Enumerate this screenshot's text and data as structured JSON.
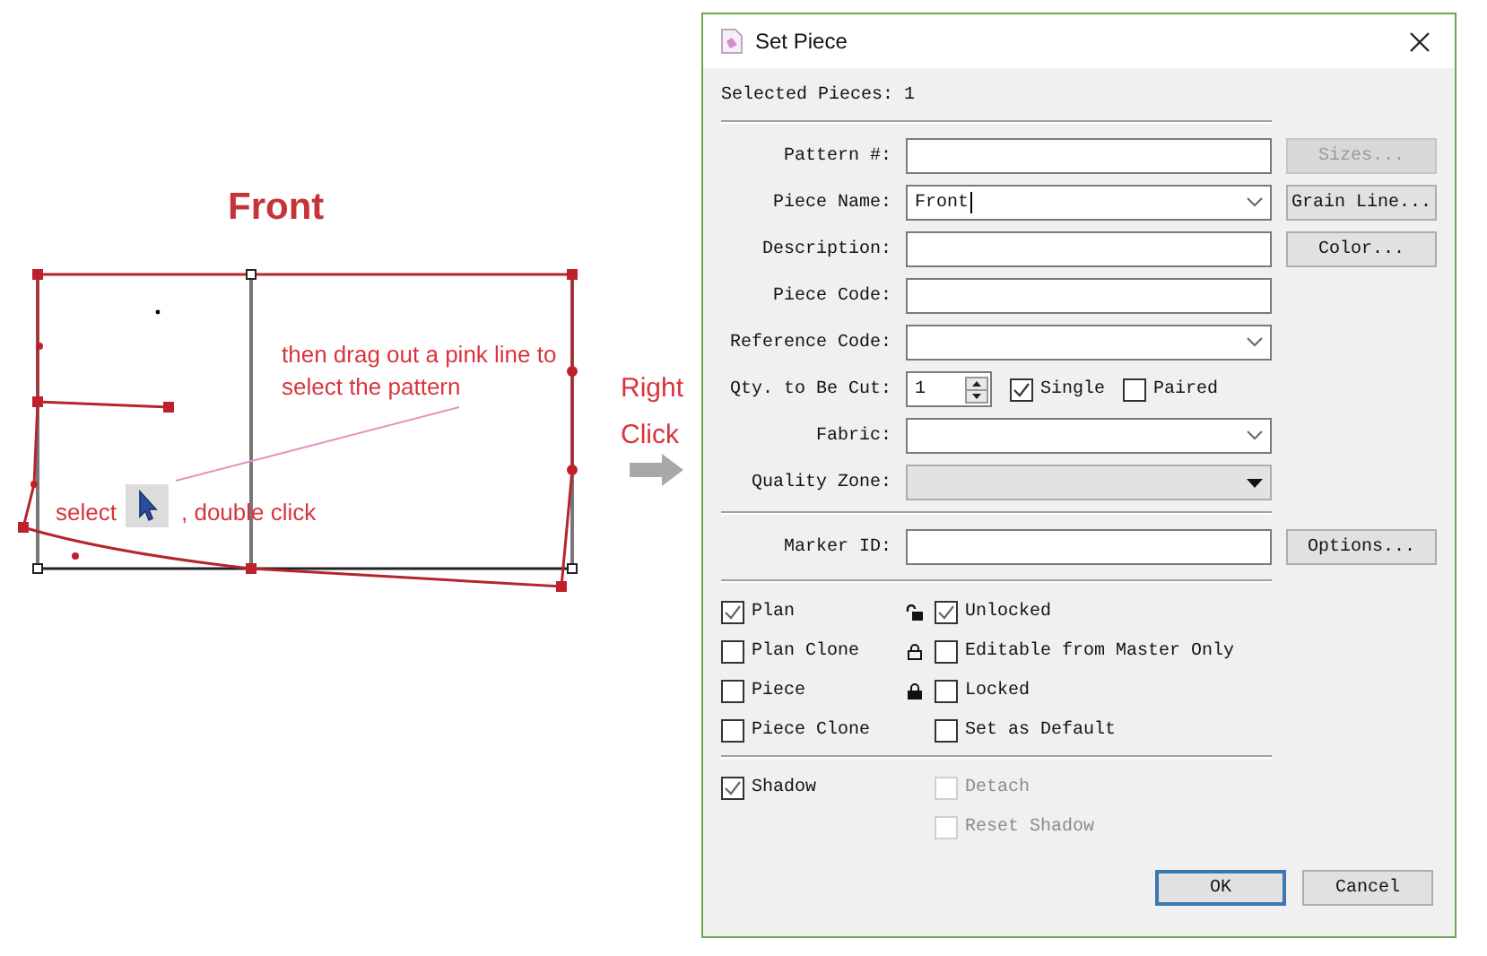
{
  "diagram": {
    "title": "Front",
    "note_top": "then drag out a pink line to select the pattern",
    "note_select": "select",
    "note_click": ", double click",
    "note_right": "Right Click"
  },
  "dialog": {
    "title": "Set Piece",
    "selected_pieces": "Selected Pieces: 1",
    "fields": [
      {
        "label": "Pattern #:",
        "kind": "text",
        "button": {
          "label": "Sizes...",
          "disabled": true
        }
      },
      {
        "label": "Piece Name:",
        "kind": "combo",
        "value": "Front",
        "button": {
          "label": "Grain Line...",
          "disabled": false
        }
      },
      {
        "label": "Description:",
        "kind": "text",
        "button": {
          "label": "Color...",
          "disabled": false
        }
      },
      {
        "label": "Piece Code:",
        "kind": "text"
      },
      {
        "label": "Reference Code:",
        "kind": "combo"
      },
      {
        "label": "Qty. to Be Cut:",
        "kind": "spin",
        "value": "1",
        "options": [
          {
            "label": "Single",
            "checked": true
          },
          {
            "label": "Paired",
            "checked": false
          }
        ]
      },
      {
        "label": "Fabric:",
        "kind": "combo"
      },
      {
        "label": "Quality Zone:",
        "kind": "dropdown"
      }
    ],
    "marker": {
      "label": "Marker ID:",
      "button": "Options..."
    },
    "flags_left": [
      {
        "label": "Plan",
        "checked": true,
        "disabled": false
      },
      {
        "label": "Plan Clone",
        "checked": false,
        "disabled": false
      },
      {
        "label": "Piece",
        "checked": false,
        "disabled": false
      },
      {
        "label": "Piece Clone",
        "checked": false,
        "disabled": false
      }
    ],
    "flags_right": [
      {
        "label": "Unlocked",
        "checked": true,
        "disabled": false,
        "kind": "unlocked"
      },
      {
        "label": "Editable from Master Only",
        "checked": false,
        "disabled": false,
        "kind": "editable"
      },
      {
        "label": "Locked",
        "checked": false,
        "disabled": false,
        "kind": "locked"
      },
      {
        "label": "Set as Default",
        "checked": false,
        "disabled": false,
        "kind": "plain"
      }
    ],
    "shadow_left": [
      {
        "label": "Shadow",
        "checked": true,
        "disabled": false
      }
    ],
    "shadow_right": [
      {
        "label": "Detach",
        "checked": false,
        "disabled": true
      },
      {
        "label": "Reset Shadow",
        "checked": false,
        "disabled": true
      }
    ],
    "buttons": [
      {
        "label": "OK",
        "default": true
      },
      {
        "label": "Cancel",
        "default": false
      }
    ]
  }
}
